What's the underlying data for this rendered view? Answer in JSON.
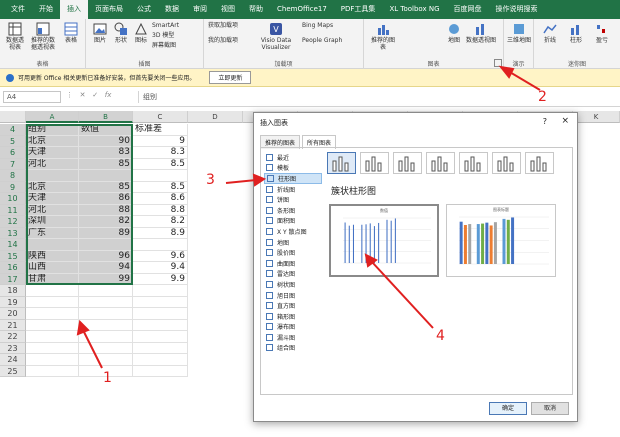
{
  "menu": {
    "tabs": [
      "文件",
      "开始",
      "插入",
      "页面布局",
      "公式",
      "数据",
      "审阅",
      "视图",
      "帮助",
      "ChemOffice17",
      "PDF工具集",
      "XL Toolbox NG",
      "百度网盘",
      "操作说明搜索"
    ],
    "active_index": 2
  },
  "ribbon": {
    "groups": [
      {
        "label": "表格",
        "buttons": [
          "数据透视表",
          "推荐的数据透视表",
          "表格"
        ]
      },
      {
        "label": "插图",
        "buttons": [
          "图片",
          "形状",
          "图标",
          "SmartArt",
          "3D 模型",
          "屏幕截图"
        ]
      },
      {
        "label": "加载项",
        "buttons": [
          "获取加载项",
          "我的加载项",
          "Visio Data Visualizer",
          "Bing Maps",
          "People Graph"
        ]
      },
      {
        "label": "图表",
        "buttons": [
          "推荐的图表",
          "地图",
          "数据透视图"
        ]
      },
      {
        "label": "演示",
        "buttons": [
          "三维地图"
        ]
      },
      {
        "label": "迷你图",
        "buttons": [
          "折线",
          "柱形",
          "盈亏"
        ]
      }
    ]
  },
  "message_bar": {
    "text": "可用更新  Office 相关更新已准备好安装，但首先要关闭一些应用。",
    "button": "立即更新"
  },
  "formula_bar": {
    "name_box": "A4",
    "value": "组别"
  },
  "sheet": {
    "columns": [
      "A",
      "B",
      "C",
      "D",
      "E",
      "F",
      "G",
      "H",
      "I",
      "J",
      "K"
    ],
    "rows": [
      {
        "n": "4",
        "a": "组别",
        "b": "数值",
        "c": "标准差"
      },
      {
        "n": "5",
        "a": "北京",
        "b": "90",
        "c": "9"
      },
      {
        "n": "6",
        "a": "天津",
        "b": "83",
        "c": "8.3"
      },
      {
        "n": "7",
        "a": "河北",
        "b": "85",
        "c": "8.5"
      },
      {
        "n": "8",
        "a": "",
        "b": "",
        "c": ""
      },
      {
        "n": "9",
        "a": "北京",
        "b": "85",
        "c": "8.5"
      },
      {
        "n": "10",
        "a": "天津",
        "b": "86",
        "c": "8.6"
      },
      {
        "n": "11",
        "a": "河北",
        "b": "88",
        "c": "8.8"
      },
      {
        "n": "12",
        "a": "深圳",
        "b": "82",
        "c": "8.2"
      },
      {
        "n": "13",
        "a": "广东",
        "b": "89",
        "c": "8.9"
      },
      {
        "n": "14",
        "a": "",
        "b": "",
        "c": ""
      },
      {
        "n": "15",
        "a": "陕西",
        "b": "96",
        "c": "9.6"
      },
      {
        "n": "16",
        "a": "山西",
        "b": "94",
        "c": "9.4"
      },
      {
        "n": "17",
        "a": "甘肃",
        "b": "99",
        "c": "9.9"
      },
      {
        "n": "18",
        "a": "",
        "b": "",
        "c": ""
      },
      {
        "n": "19",
        "a": "",
        "b": "",
        "c": ""
      },
      {
        "n": "20",
        "a": "",
        "b": "",
        "c": ""
      },
      {
        "n": "21",
        "a": "",
        "b": "",
        "c": ""
      },
      {
        "n": "22",
        "a": "",
        "b": "",
        "c": ""
      },
      {
        "n": "23",
        "a": "",
        "b": "",
        "c": ""
      },
      {
        "n": "24",
        "a": "",
        "b": "",
        "c": ""
      },
      {
        "n": "25",
        "a": "",
        "b": "",
        "c": ""
      }
    ]
  },
  "dialog": {
    "title": "插入图表",
    "help": "?",
    "close": "×",
    "tabs": [
      "推荐的图表",
      "所有图表"
    ],
    "active_tab": 1,
    "chart_types": [
      "最近",
      "模板",
      "柱形图",
      "折线图",
      "饼图",
      "条形图",
      "面积图",
      "X Y 散点图",
      "地图",
      "股价图",
      "曲面图",
      "雷达图",
      "树状图",
      "旭日图",
      "直方图",
      "箱形图",
      "瀑布图",
      "漏斗图",
      "组合图"
    ],
    "active_type": 2,
    "subtype_title": "簇状柱形图",
    "preview_titles": [
      "数值",
      "图表标题"
    ],
    "ok": "确定",
    "cancel": "取消"
  },
  "annotations": [
    "1",
    "2",
    "3",
    "4"
  ],
  "colors": {
    "excel_green": "#217346",
    "bar_blue": "#4472c4",
    "annotation_red": "#e02020"
  }
}
